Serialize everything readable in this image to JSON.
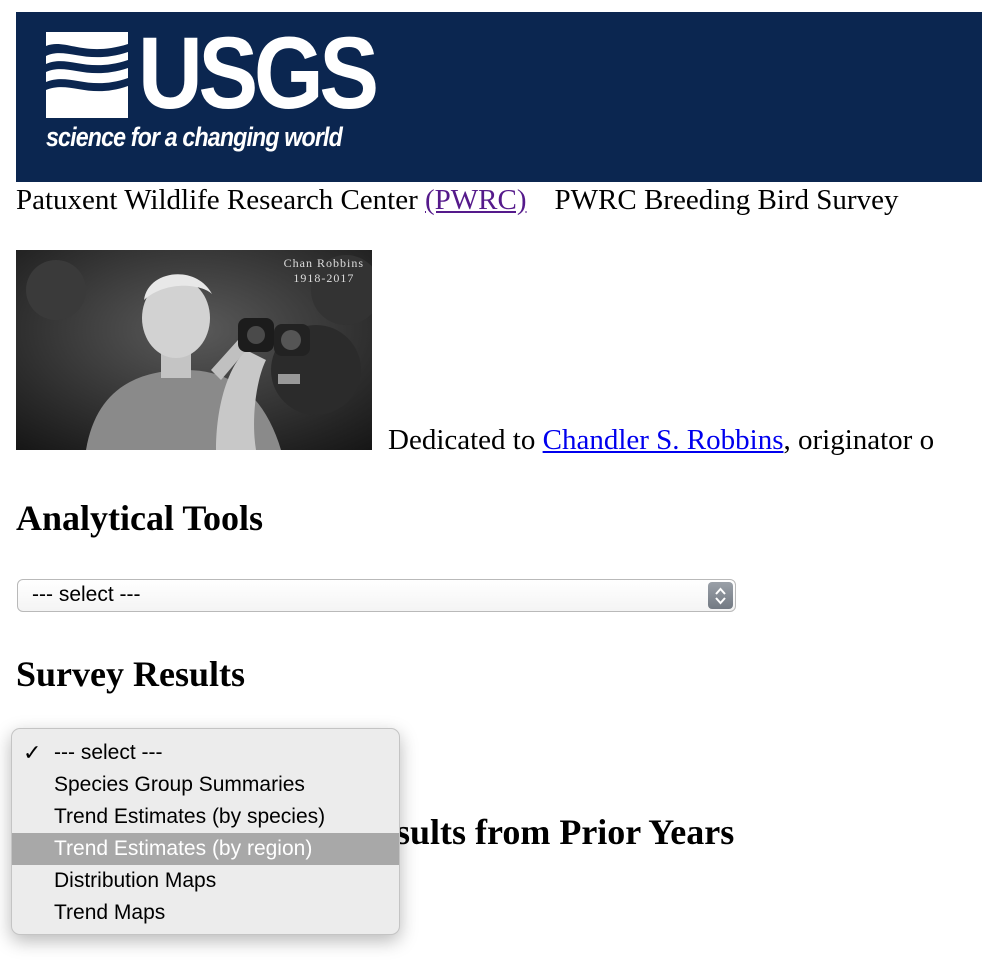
{
  "header": {
    "logo_word": "USGS",
    "logo_tagline": "science for a changing world",
    "banner_color": "#0b2650"
  },
  "nav": {
    "center_text": "Patuxent Wildlife Research Center",
    "center_link": "(PWRC)",
    "survey_text": "PWRC Breeding Bird Survey"
  },
  "photo": {
    "caption_name": "Chan Robbins",
    "caption_years": "1918-2017"
  },
  "dedication": {
    "prefix": "Dedicated to",
    "link": "Chandler S. Robbins",
    "suffix": ", originator o"
  },
  "sections": {
    "analytical_tools": "Analytical Tools",
    "survey_results": "Survey Results",
    "prior_years_visible": "sults from Prior Years"
  },
  "analytical_select": {
    "value": "--- select ---"
  },
  "survey_dropdown": {
    "checkmark": "✓",
    "options": [
      "--- select ---",
      "Species Group Summaries",
      "Trend Estimates (by species)",
      "Trend Estimates (by region)",
      "Distribution Maps",
      "Trend Maps"
    ],
    "checked_index": 0,
    "highlighted_index": 3
  }
}
